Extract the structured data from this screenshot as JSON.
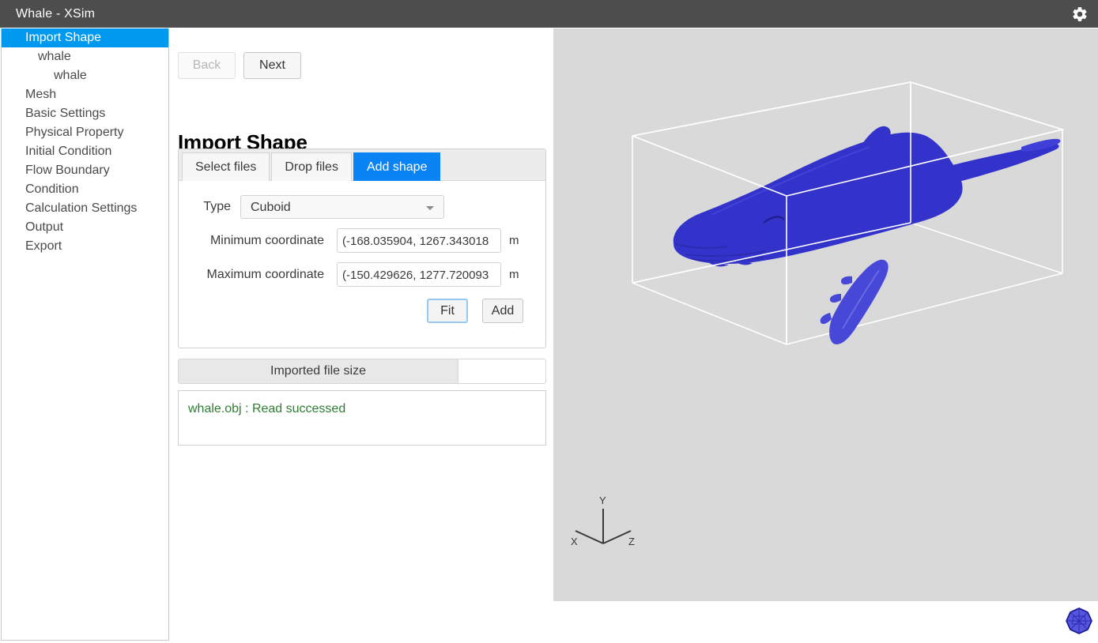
{
  "window": {
    "title": "Whale - XSim",
    "settings_icon": "gear-icon"
  },
  "sidebar": {
    "items": [
      {
        "label": "Import Shape",
        "level": 0,
        "selected": true
      },
      {
        "label": "whale",
        "level": 1,
        "selected": false
      },
      {
        "label": "whale",
        "level": 2,
        "selected": false
      },
      {
        "label": "Mesh",
        "level": 0,
        "selected": false
      },
      {
        "label": "Basic Settings",
        "level": 0,
        "selected": false
      },
      {
        "label": "Physical Property",
        "level": 0,
        "selected": false
      },
      {
        "label": "Initial Condition",
        "level": 0,
        "selected": false
      },
      {
        "label": "Flow Boundary",
        "level": 0,
        "selected": false
      },
      {
        "label": "Condition",
        "level": 0,
        "selected": false
      },
      {
        "label": "Calculation Settings",
        "level": 0,
        "selected": false
      },
      {
        "label": "Output",
        "level": 0,
        "selected": false
      },
      {
        "label": "Export",
        "level": 0,
        "selected": false
      }
    ]
  },
  "main": {
    "back_label": "Back",
    "next_label": "Next",
    "page_title": "Import Shape",
    "tabs": [
      {
        "label": "Select files",
        "active": false
      },
      {
        "label": "Drop files",
        "active": false
      },
      {
        "label": "Add shape",
        "active": true
      }
    ],
    "form": {
      "type_label": "Type",
      "type_value": "Cuboid",
      "type_options": [
        "Cuboid"
      ],
      "min_label": "Minimum coordinate",
      "min_value": "(-168.035904, 1267.343018",
      "min_unit": "m",
      "max_label": "Maximum coordinate",
      "max_value": "(-150.429626, 1277.720093",
      "max_unit": "m",
      "fit_label": "Fit",
      "add_label": "Add"
    },
    "filesize": {
      "label": "Imported file size",
      "value": ""
    },
    "log": {
      "lines": [
        "whale.obj : Read successed"
      ]
    }
  },
  "viewport": {
    "background_color": "#d9d9d9",
    "model_color": "#3333cc",
    "bbox_color": "#ffffff",
    "axis_labels": {
      "x": "X",
      "y": "Y",
      "z": "Z"
    },
    "nav_gizmo": "polyhedron-icon"
  },
  "colors": {
    "titlebar": "#4d4d4d",
    "accent": "#0a84f5",
    "log_success": "#2f7d32"
  }
}
